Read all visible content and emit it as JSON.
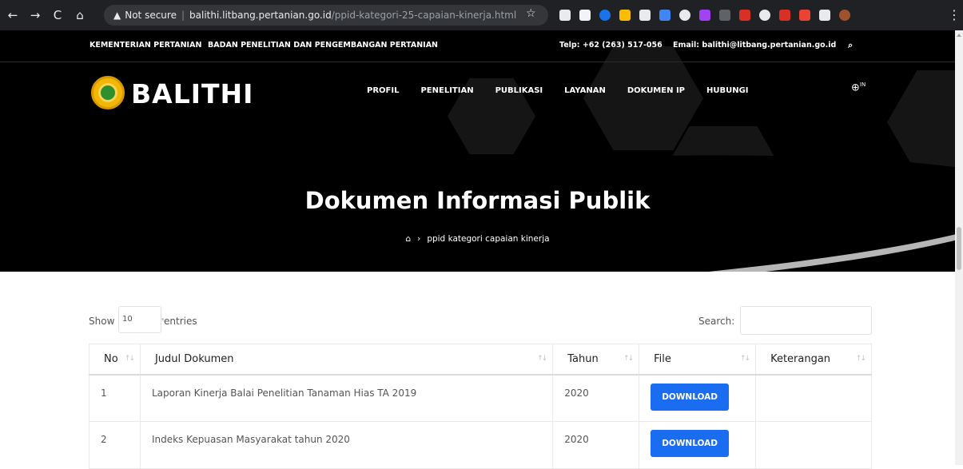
{
  "browser": {
    "security_label": "Not secure",
    "url_host": "balithi.litbang.pertanian.go.id",
    "url_path": "/ppid-kategori-25-capaian-kinerja.html",
    "extension_colors": [
      "#e8eaed",
      "#f1f3f4",
      "#1a73e8",
      "#fbbc04",
      "#e8eaed",
      "#4285f4",
      "#e8eaed",
      "#a142f4",
      "#5f6368",
      "#d93025",
      "#e8eaed",
      "#d93025",
      "#ea4335",
      "#e8eaed",
      "#a0522d"
    ]
  },
  "topbar": {
    "ministry": "KEMENTERIAN PERTANIAN",
    "agency": "BADAN PENELITIAN DAN PENGEMBANGAN PERTANIAN",
    "phone": "Telp: +62 (263) 517-056",
    "email": "Email: balithi@litbang.pertanian.go.id"
  },
  "header": {
    "brand": "BALITHI",
    "nav": [
      "PROFIL",
      "PENELITIAN",
      "PUBLIKASI",
      "LAYANAN",
      "DOKUMEN IP",
      "HUBUNGI"
    ],
    "lang": "IN"
  },
  "hero": {
    "title": "Dokumen Informasi Publik",
    "breadcrumb": "ppid kategori capaian kinerja"
  },
  "controls": {
    "show_label": "Show",
    "page_length": "10",
    "entries_label": "entries",
    "search_label": "Search:"
  },
  "table": {
    "columns": [
      "No",
      "Judul Dokumen",
      "Tahun",
      "File",
      "Keterangan"
    ],
    "rows": [
      {
        "no": "1",
        "judul": "Laporan Kinerja Balai Penelitian Tanaman Hias TA 2019",
        "tahun": "2020",
        "file": "DOWNLOAD",
        "keterangan": ""
      },
      {
        "no": "2",
        "judul": "Indeks Kepuasan Masyarakat tahun 2020",
        "tahun": "2020",
        "file": "DOWNLOAD",
        "keterangan": ""
      }
    ]
  }
}
